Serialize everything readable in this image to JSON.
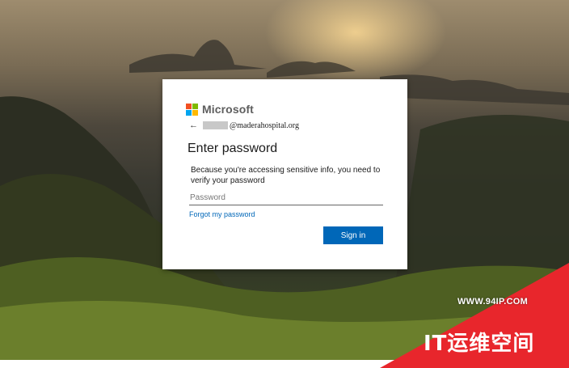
{
  "brand": {
    "name": "Microsoft",
    "logo_colors": [
      "#f25022",
      "#7fba00",
      "#00a4ef",
      "#ffb900"
    ]
  },
  "identity": {
    "back_icon": "back-arrow-icon",
    "email_domain": "@maderahospital.org"
  },
  "page": {
    "title": "Enter password",
    "description": "Because you're accessing sensitive info, you need to verify your password"
  },
  "password": {
    "placeholder": "Password",
    "value": ""
  },
  "links": {
    "forgot": "Forgot my password"
  },
  "actions": {
    "signin": "Sign in"
  },
  "colors": {
    "accent": "#0067b8"
  },
  "watermark": {
    "url": "WWW.94IP.COM",
    "text": "IT运维空间",
    "color": "#e8262c"
  }
}
